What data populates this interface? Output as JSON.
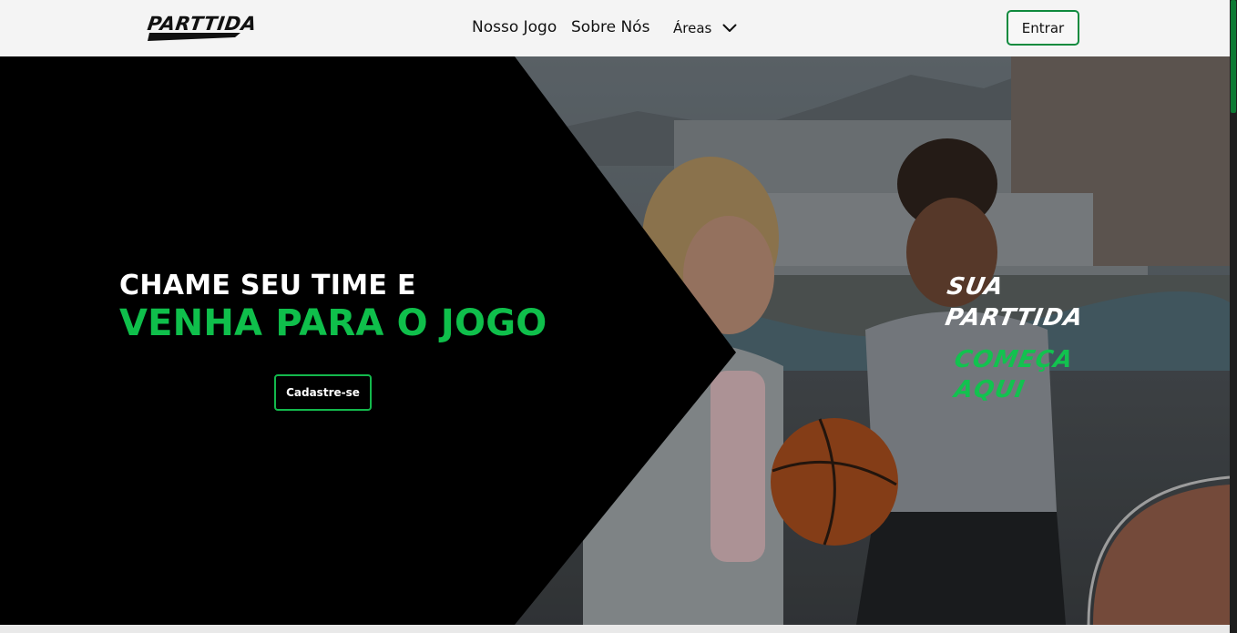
{
  "header": {
    "logo_text": "PARTTIDA",
    "nav": {
      "nosso_jogo": "Nosso Jogo",
      "sobre_nos": "Sobre Nós",
      "areas": "Áreas"
    },
    "login_button": "Entrar"
  },
  "hero": {
    "headline_line1": "CHAME SEU TIME E",
    "headline_line2": "VENHA PARA O JOGO",
    "signup_button": "Cadastre-se",
    "tagline": {
      "line1": "SUA",
      "line2": "PARTTIDA",
      "line3": "COMEÇA",
      "line4": "AQUI"
    }
  },
  "colors": {
    "accent_green": "#0fbf4b",
    "button_border": "#0f8a3e",
    "dark": "#000000"
  },
  "icons": [
    "chevron-down-icon"
  ]
}
